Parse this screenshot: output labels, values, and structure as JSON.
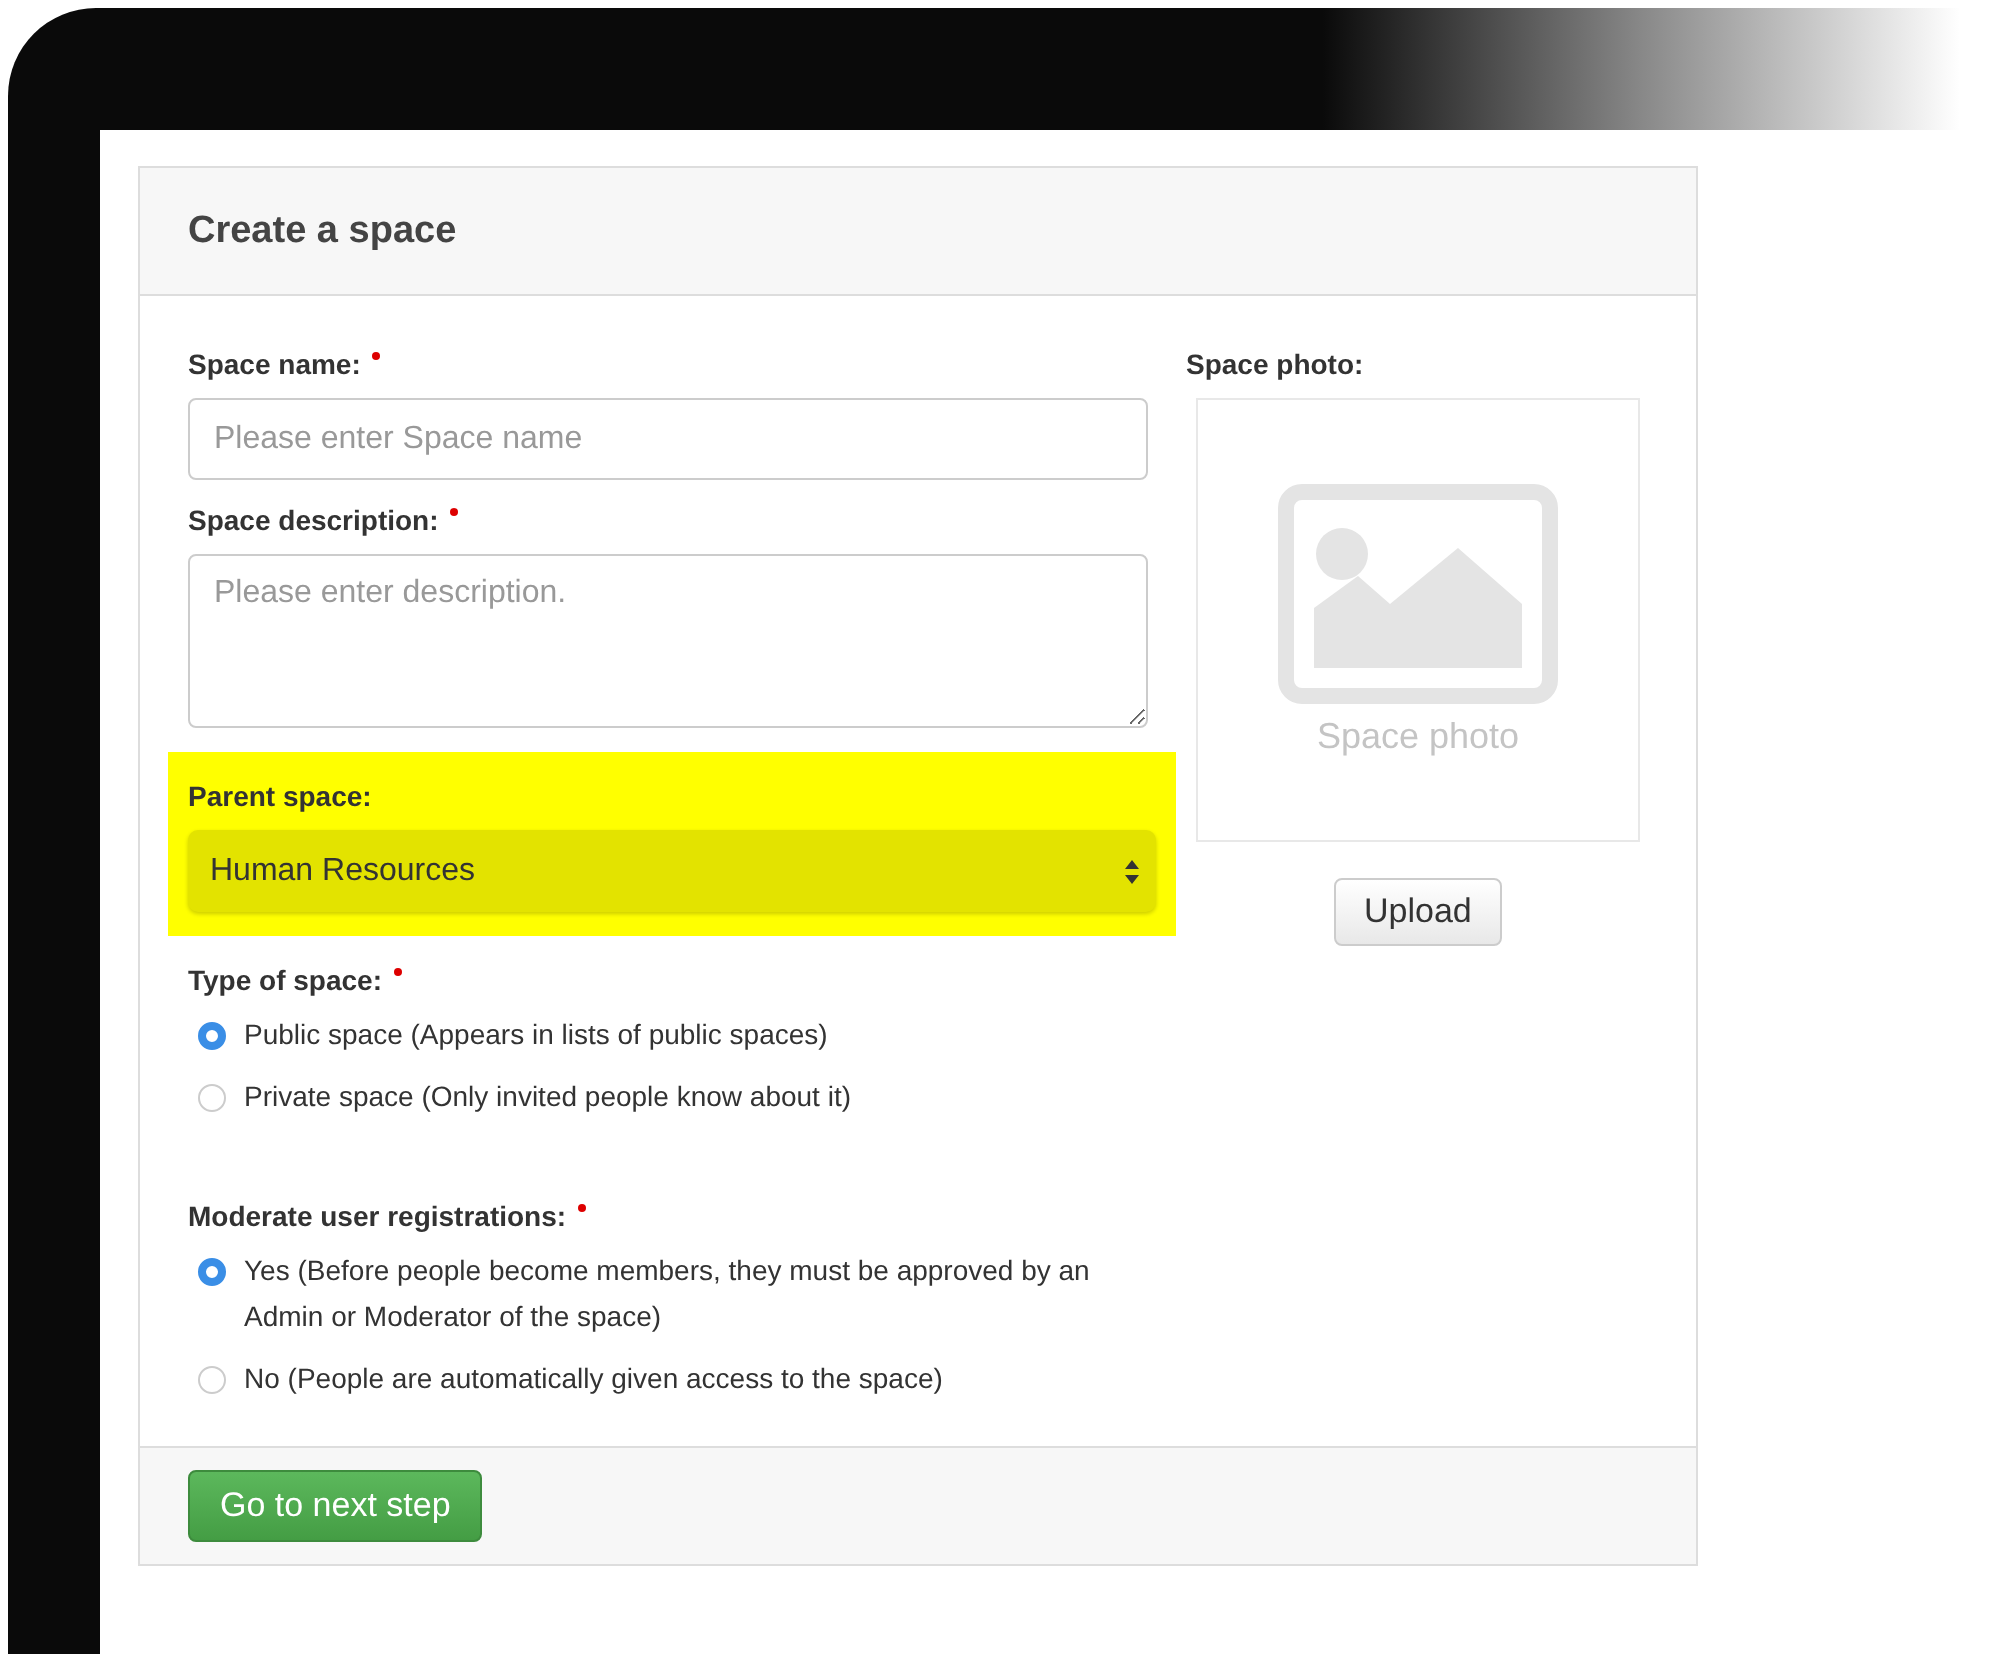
{
  "card": {
    "title": "Create a space"
  },
  "fields": [
    {
      "kind": "text",
      "label": "Space name:",
      "required": true,
      "placeholder": "Please enter Space name",
      "highlighted": false
    },
    {
      "kind": "textarea",
      "label": "Space description:",
      "required": true,
      "placeholder": "Please enter description.",
      "highlighted": false
    },
    {
      "kind": "select",
      "label": "Parent space:",
      "required": false,
      "value": "Human Resources",
      "highlighted": true
    }
  ],
  "radio_groups": [
    {
      "label": "Type of space:",
      "required": true,
      "options": [
        {
          "label": "Public space (Appears in lists of public spaces)",
          "selected": true
        },
        {
          "label": "Private space (Only invited people know about it)",
          "selected": false
        }
      ]
    },
    {
      "label": "Moderate user registrations:",
      "required": true,
      "options": [
        {
          "label": "Yes (Before people become members, they must be approved by an Admin or Moderator of the space)",
          "selected": true
        },
        {
          "label": "No (People are automatically given access to the space)",
          "selected": false
        }
      ]
    }
  ],
  "photo": {
    "label": "Space photo:",
    "placeholder_text": "Space photo",
    "button": "Upload"
  },
  "footer": {
    "button": "Go to next step"
  }
}
